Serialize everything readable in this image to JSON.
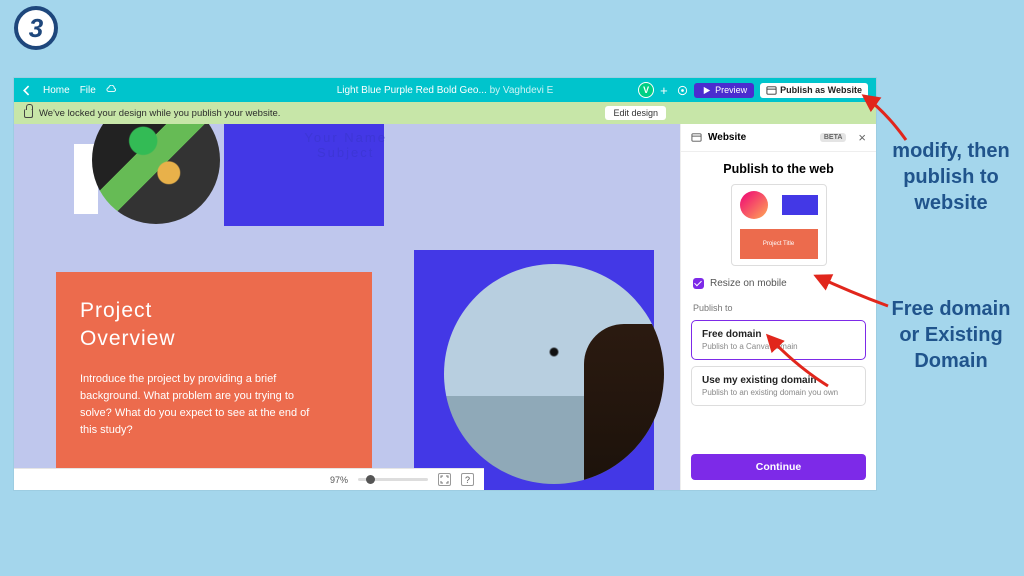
{
  "step_number": "3",
  "topbar": {
    "home": "Home",
    "file": "File",
    "doc_title": "Light Blue Purple Red Bold Geo...",
    "by": "by",
    "author": "Vaghdevi E",
    "avatar_letter": "V",
    "preview": "Preview",
    "publish": "Publish as Website"
  },
  "notice": {
    "text": "We've locked your design while you publish your website.",
    "edit": "Edit design"
  },
  "design": {
    "your_name": "Your Name",
    "subject": "Subject",
    "overview_title_1": "Project",
    "overview_title_2": "Overview",
    "overview_body": "Introduce the project by providing a brief background. What problem are you trying to solve? What do you expect to see at the end of this study?"
  },
  "bottom": {
    "zoom": "97%",
    "help": "?"
  },
  "panel": {
    "tab": "Website",
    "beta": "BETA",
    "title": "Publish to the web",
    "preview_caption": "Project Title",
    "resize": "Resize on mobile",
    "publish_to": "Publish to",
    "opt1_title": "Free domain",
    "opt1_desc": "Publish to a Canva domain",
    "opt2_title": "Use my existing domain",
    "opt2_desc": "Publish to an existing domain you own",
    "continue": "Continue"
  },
  "annotations": {
    "a1": "modify, then publish to website",
    "a2": "Free domain or Existing Domain"
  }
}
